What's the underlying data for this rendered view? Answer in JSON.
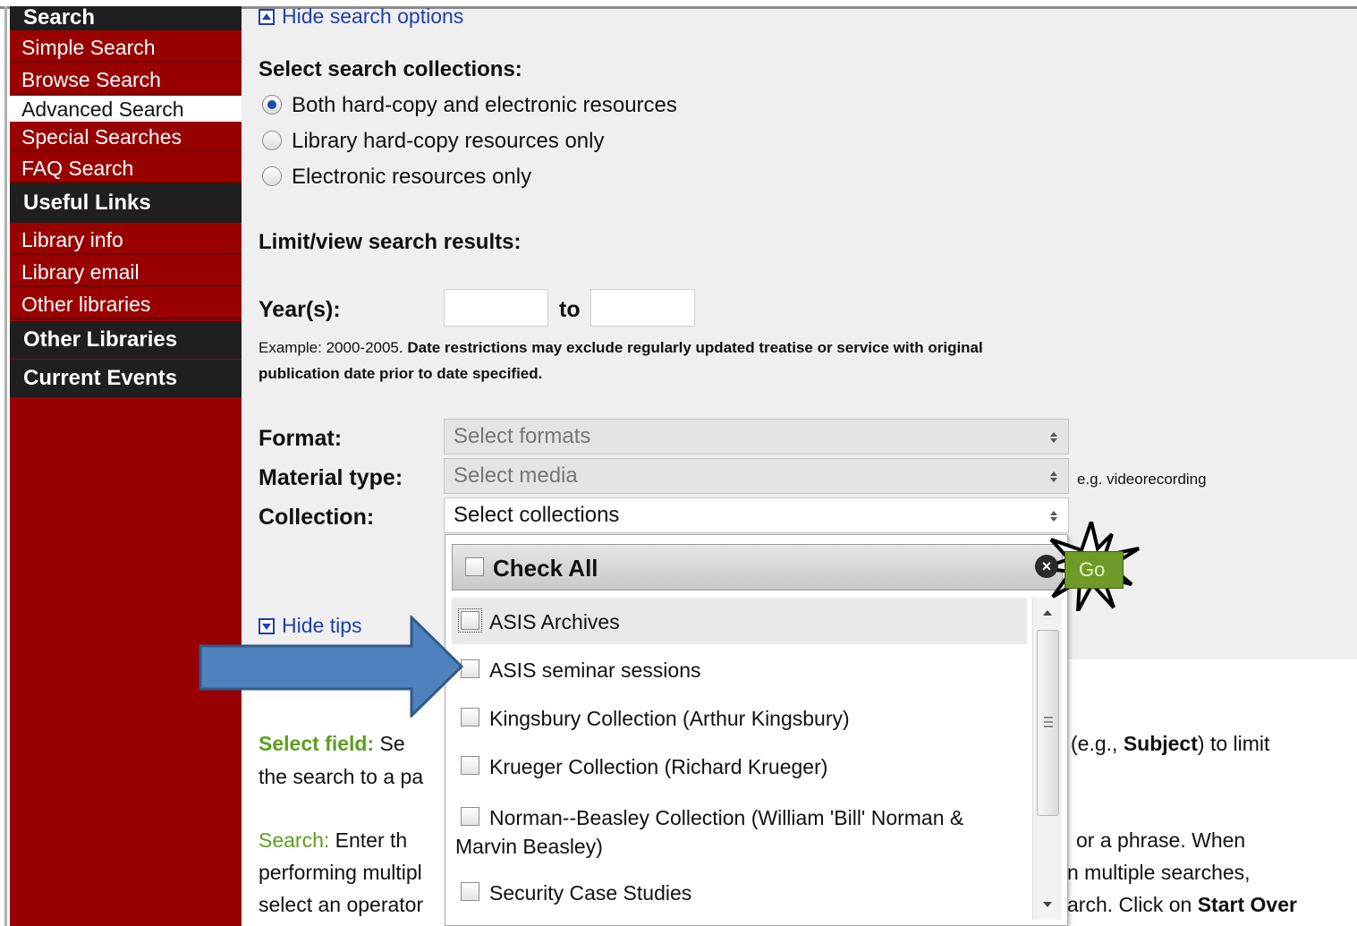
{
  "sidebar": {
    "search_heading": "Search",
    "search_items": [
      {
        "label": "Simple Search"
      },
      {
        "label": "Browse Search"
      },
      {
        "label": "Advanced Search"
      },
      {
        "label": "Special Searches"
      },
      {
        "label": "FAQ Search"
      }
    ],
    "useful_links_heading": "Useful Links",
    "useful_items": [
      {
        "label": "Library info"
      },
      {
        "label": "Library email"
      },
      {
        "label": "Other libraries"
      }
    ],
    "other_libraries_heading": "Other Libraries",
    "current_events_heading": "Current Events"
  },
  "options": {
    "hide_search_options": "Hide search options",
    "collections_heading": "Select search collections:",
    "radios": [
      {
        "label": "Both hard-copy and electronic resources",
        "checked": true
      },
      {
        "label": "Library hard-copy resources only",
        "checked": false
      },
      {
        "label": "Electronic resources only",
        "checked": false
      }
    ],
    "limit_heading": "Limit/view search results:",
    "years_label": "Year(s):",
    "to_label": "to",
    "year_from": "",
    "year_to": "",
    "example_prefix": "Example: 2000-2005.",
    "example_bold_line1": "Date restrictions may exclude regularly updated treatise or service with original",
    "example_bold_line2": "publication date prior to date specified.",
    "format_label": "Format:",
    "format_value": "Select formats",
    "material_label": "Material type:",
    "material_value": "Select media",
    "material_hint": "e.g. videorecording",
    "collection_label": "Collection:",
    "collection_value": "Select collections",
    "go_label": "Go",
    "hide_tips": "Hide tips"
  },
  "dropdown": {
    "check_all": "Check All",
    "close_glyph": "×",
    "items": [
      {
        "label": "ASIS Archives"
      },
      {
        "label": "ASIS seminar sessions"
      },
      {
        "label": "Kingsbury Collection (Arthur Kingsbury)"
      },
      {
        "label": "Krueger Collection (Richard Krueger)"
      },
      {
        "label": "Norman--Beasley Collection (William 'Bill' Norman &",
        "line2": "Marvin Beasley)"
      },
      {
        "label": "Security Case Studies"
      }
    ]
  },
  "tips": {
    "select_field_label": "Select field:",
    "select_field_a": "Se",
    "eg_prefix": "(e.g., ",
    "eg_bold": "Subject",
    "eg_suffix": ") to limit",
    "line2_a": "the search to a pa",
    "search_label": "Search:",
    "search_a": "Enter th",
    "search_b": "or a phrase. When",
    "line4_a": "performing multipl",
    "line4_b": "n multiple searches,",
    "line5_a": "select an operator",
    "line5_b": "arch. Click on ",
    "start_over": "Start Over"
  },
  "colors": {
    "sidebar_bg": "#990000",
    "sidebar_heading_bg": "#1f1f1f",
    "link_blue": "#1f3fb0",
    "tip_green": "#5c9e1f",
    "go_green": "#6e9b27",
    "annotation_arrow": "#4f81bd"
  },
  "icons": {
    "hide_options_icon": "collapse-up-square-icon",
    "hide_tips_icon": "collapse-down-square-icon",
    "close_icon": "close-circle-icon",
    "annotation_arrow": "right-arrow-annotation-icon",
    "highlight_burst": "starburst-icon"
  }
}
